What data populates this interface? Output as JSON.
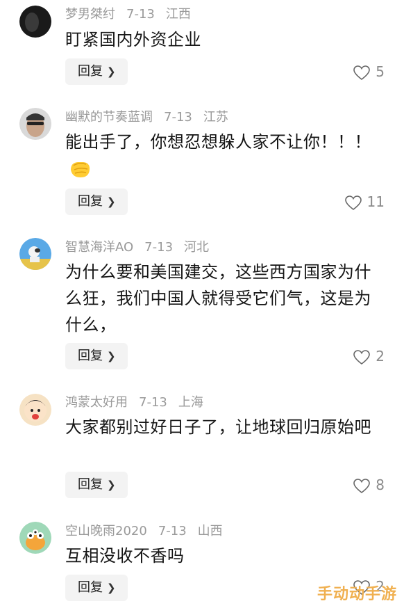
{
  "comments": [
    {
      "user": "梦男桀纣",
      "date": "7-13",
      "region": "江西",
      "text": "盯紧国内外资企业",
      "reply": "回复",
      "likes": "5"
    },
    {
      "user": "幽默的节奏蓝调",
      "date": "7-13",
      "region": "江苏",
      "text": "能出手了，你想忍想躲人家不让你！！！",
      "reply": "回复",
      "likes": "11"
    },
    {
      "user": "智慧海洋AO",
      "date": "7-13",
      "region": "河北",
      "text": "为什么要和美国建交，这些西方国家为什么狂，我们中国人就得受它们气，这是为什么，",
      "reply": "回复",
      "likes": "2"
    },
    {
      "user": "鸿蒙太好用",
      "date": "7-13",
      "region": "上海",
      "text": "大家都别过好日子了，让地球回归原始吧",
      "reply": "回复",
      "likes": "8"
    },
    {
      "user": "空山晚雨2020",
      "date": "7-13",
      "region": "山西",
      "text": "互相没收不香吗",
      "reply": "回复",
      "likes": "2"
    }
  ],
  "watermark": "手动动手游",
  "icons": {
    "like": "heart-icon",
    "chevron": "chevron-right-icon",
    "emoji": "clapping-hands-emoji"
  }
}
